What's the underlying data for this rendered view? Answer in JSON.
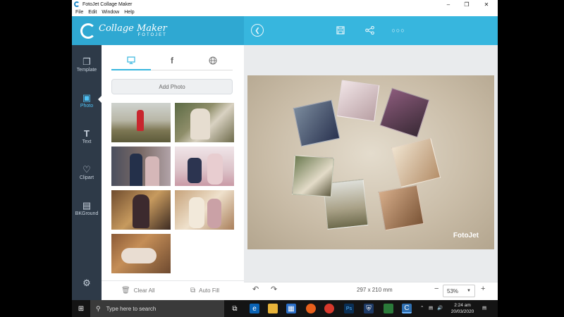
{
  "window": {
    "title": "FotoJet Collage Maker"
  },
  "menu": [
    "File",
    "Edit",
    "Window",
    "Help"
  ],
  "header": {
    "logo_text": "Collage Maker",
    "logo_sub": "FOTOJET"
  },
  "rail": [
    {
      "label": "Template",
      "icon": "template-icon"
    },
    {
      "label": "Photo",
      "icon": "photo-icon",
      "active": true
    },
    {
      "label": "Text",
      "icon": "text-icon"
    },
    {
      "label": "Clipart",
      "icon": "heart-icon"
    },
    {
      "label": "BKGround",
      "icon": "stripes-icon"
    }
  ],
  "panel": {
    "tabs": [
      "computer-icon",
      "facebook-icon",
      "web-icon"
    ],
    "add_photo": "Add Photo",
    "clear_all": "Clear All",
    "auto_fill": "Auto Fill"
  },
  "canvas": {
    "watermark": "FotoJet",
    "size": "297 x 210 mm"
  },
  "zoom": {
    "value": "53%"
  },
  "taskbar": {
    "search_placeholder": "Type here to search",
    "time": "2:24 am",
    "date": "20/03/2020"
  },
  "colors": {
    "accent": "#37b6de",
    "rail": "#2e3a48",
    "canvas_bg": "#c9bca7"
  }
}
